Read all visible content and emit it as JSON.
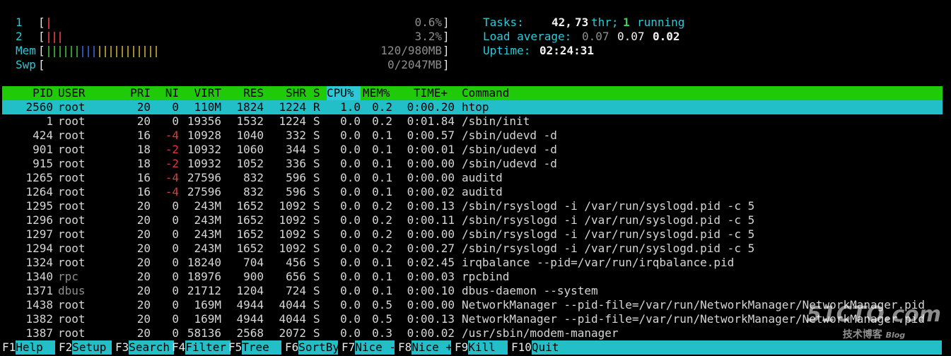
{
  "meters": {
    "cpu1": {
      "label": "1",
      "value": "0.6%"
    },
    "cpu2": {
      "label": "2",
      "value": "3.2%"
    },
    "mem": {
      "label": "Mem",
      "value": "120/980MB"
    },
    "swp": {
      "label": "Swp",
      "value": "0/2047MB"
    }
  },
  "summary": {
    "tasks_label": "Tasks:",
    "tasks": "42,",
    "threads": "73",
    "thr_label": "thr;",
    "running": "1",
    "running_label": "running",
    "load_label": "Load average:",
    "load1": "0.07",
    "load5": "0.07",
    "load15": "0.02",
    "uptime_label": "Uptime:",
    "uptime": "02:24:31"
  },
  "columns": {
    "pid": "PID",
    "user": "USER",
    "pri": "PRI",
    "ni": "NI",
    "virt": "VIRT",
    "res": "RES",
    "shr": "SHR",
    "s": "S",
    "cpu": "CPU%",
    "mem": "MEM%",
    "time": "TIME+",
    "command": "Command"
  },
  "processes": [
    {
      "pid": "2560",
      "user": "root",
      "pri": "20",
      "ni": "0",
      "virt": "110M",
      "res": "1824",
      "shr": "1224",
      "s": "R",
      "cpu": "1.0",
      "mem": "0.2",
      "time": "0:00.20",
      "command": "htop"
    },
    {
      "pid": "1",
      "user": "root",
      "pri": "20",
      "ni": "0",
      "virt": "19356",
      "res": "1532",
      "shr": "1224",
      "s": "S",
      "cpu": "0.0",
      "mem": "0.2",
      "time": "0:01.84",
      "command": "/sbin/init"
    },
    {
      "pid": "424",
      "user": "root",
      "pri": "16",
      "ni": "-4",
      "virt": "10928",
      "res": "1040",
      "shr": "332",
      "s": "S",
      "cpu": "0.0",
      "mem": "0.1",
      "time": "0:00.57",
      "command": "/sbin/udevd -d"
    },
    {
      "pid": "901",
      "user": "root",
      "pri": "18",
      "ni": "-2",
      "virt": "10932",
      "res": "1060",
      "shr": "344",
      "s": "S",
      "cpu": "0.0",
      "mem": "0.1",
      "time": "0:00.01",
      "command": "/sbin/udevd -d"
    },
    {
      "pid": "915",
      "user": "root",
      "pri": "18",
      "ni": "-2",
      "virt": "10932",
      "res": "1052",
      "shr": "336",
      "s": "S",
      "cpu": "0.0",
      "mem": "0.1",
      "time": "0:00.00",
      "command": "/sbin/udevd -d"
    },
    {
      "pid": "1265",
      "user": "root",
      "pri": "16",
      "ni": "-4",
      "virt": "27596",
      "res": "832",
      "shr": "596",
      "s": "S",
      "cpu": "0.0",
      "mem": "0.1",
      "time": "0:00.00",
      "command": "auditd"
    },
    {
      "pid": "1264",
      "user": "root",
      "pri": "16",
      "ni": "-4",
      "virt": "27596",
      "res": "832",
      "shr": "596",
      "s": "S",
      "cpu": "0.0",
      "mem": "0.1",
      "time": "0:00.02",
      "command": "auditd"
    },
    {
      "pid": "1295",
      "user": "root",
      "pri": "20",
      "ni": "0",
      "virt": "243M",
      "res": "1652",
      "shr": "1092",
      "s": "S",
      "cpu": "0.0",
      "mem": "0.2",
      "time": "0:00.13",
      "command": "/sbin/rsyslogd -i /var/run/syslogd.pid -c 5"
    },
    {
      "pid": "1296",
      "user": "root",
      "pri": "20",
      "ni": "0",
      "virt": "243M",
      "res": "1652",
      "shr": "1092",
      "s": "S",
      "cpu": "0.0",
      "mem": "0.2",
      "time": "0:00.11",
      "command": "/sbin/rsyslogd -i /var/run/syslogd.pid -c 5"
    },
    {
      "pid": "1297",
      "user": "root",
      "pri": "20",
      "ni": "0",
      "virt": "243M",
      "res": "1652",
      "shr": "1092",
      "s": "S",
      "cpu": "0.0",
      "mem": "0.2",
      "time": "0:00.00",
      "command": "/sbin/rsyslogd -i /var/run/syslogd.pid -c 5"
    },
    {
      "pid": "1294",
      "user": "root",
      "pri": "20",
      "ni": "0",
      "virt": "243M",
      "res": "1652",
      "shr": "1092",
      "s": "S",
      "cpu": "0.0",
      "mem": "0.2",
      "time": "0:00.27",
      "command": "/sbin/rsyslogd -i /var/run/syslogd.pid -c 5"
    },
    {
      "pid": "1324",
      "user": "root",
      "pri": "20",
      "ni": "0",
      "virt": "18240",
      "res": "704",
      "shr": "456",
      "s": "S",
      "cpu": "0.0",
      "mem": "0.1",
      "time": "0:02.45",
      "command": "irqbalance --pid=/var/run/irqbalance.pid"
    },
    {
      "pid": "1340",
      "user": "rpc",
      "pri": "20",
      "ni": "0",
      "virt": "18976",
      "res": "900",
      "shr": "656",
      "s": "S",
      "cpu": "0.0",
      "mem": "0.1",
      "time": "0:00.03",
      "command": "rpcbind"
    },
    {
      "pid": "1371",
      "user": "dbus",
      "pri": "20",
      "ni": "0",
      "virt": "21712",
      "res": "1204",
      "shr": "724",
      "s": "S",
      "cpu": "0.0",
      "mem": "0.1",
      "time": "0:00.10",
      "command": "dbus-daemon --system"
    },
    {
      "pid": "1438",
      "user": "root",
      "pri": "20",
      "ni": "0",
      "virt": "169M",
      "res": "4944",
      "shr": "4044",
      "s": "S",
      "cpu": "0.0",
      "mem": "0.5",
      "time": "0:00.00",
      "command": "NetworkManager --pid-file=/var/run/NetworkManager/NetworkManager.pid"
    },
    {
      "pid": "1382",
      "user": "root",
      "pri": "20",
      "ni": "0",
      "virt": "169M",
      "res": "4944",
      "shr": "4044",
      "s": "S",
      "cpu": "0.0",
      "mem": "0.5",
      "time": "0:00.13",
      "command": "NetworkManager --pid-file=/var/run/NetworkManager/NetworkManager.pid"
    },
    {
      "pid": "1387",
      "user": "root",
      "pri": "20",
      "ni": "0",
      "virt": "58136",
      "res": "2568",
      "shr": "2072",
      "s": "S",
      "cpu": "0.0",
      "mem": "0.3",
      "time": "0:00.02",
      "command": "/usr/sbin/modem-manager"
    }
  ],
  "footer": [
    {
      "key": "F1",
      "label": "Help"
    },
    {
      "key": "F2",
      "label": "Setup"
    },
    {
      "key": "F3",
      "label": "Search"
    },
    {
      "key": "F4",
      "label": "Filter"
    },
    {
      "key": "F5",
      "label": "Tree"
    },
    {
      "key": "F6",
      "label": "SortBy"
    },
    {
      "key": "F7",
      "label": "Nice -"
    },
    {
      "key": "F8",
      "label": "Nice +"
    },
    {
      "key": "F9",
      "label": "Kill"
    },
    {
      "key": "F10",
      "label": "Quit"
    }
  ],
  "watermark": {
    "main": "51CTO.com",
    "sub": "技术博客",
    "blog": "Blog"
  },
  "colors": {
    "header_bg": "#1ecb06",
    "selected_bg": "#22bfc9",
    "accent": "#2ec7d8"
  }
}
